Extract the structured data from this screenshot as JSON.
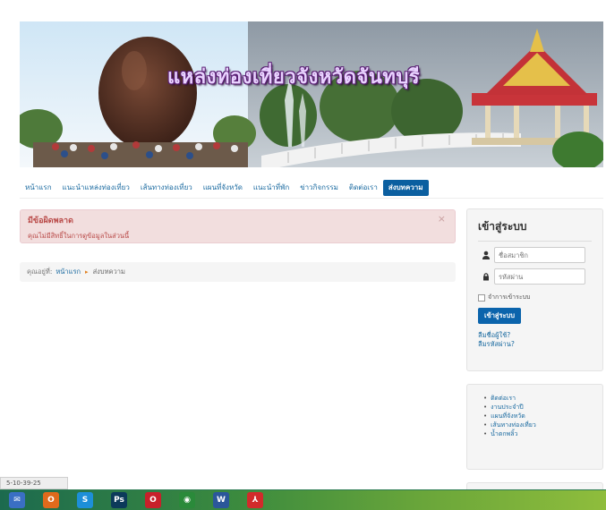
{
  "banner": {
    "title": "แหล่งท่องเที่ยวจังหวัดจันทบุรี"
  },
  "nav": {
    "items": [
      {
        "label": "หน้าแรก"
      },
      {
        "label": "แนะนำแหล่งท่องเที่ยว"
      },
      {
        "label": "เส้นทางท่องเที่ยว"
      },
      {
        "label": "แผนที่จังหวัด"
      },
      {
        "label": "แนะนำที่พัก"
      },
      {
        "label": "ข่าวกิจกรรม"
      },
      {
        "label": "ติดต่อเรา"
      },
      {
        "label": "ส่งบทความ",
        "active": true
      }
    ]
  },
  "alert": {
    "heading": "มีข้อผิดพลาด",
    "message": "คุณไม่มีสิทธิ์ในการดูข้อมูลในส่วนนี้",
    "close": "×"
  },
  "breadcrumb": {
    "prefix": "คุณอยู่ที่:",
    "home": "หน้าแรก",
    "separator": "▸",
    "current": "ส่งบทความ"
  },
  "login": {
    "title": "เข้าสู่ระบบ",
    "username_placeholder": "ชื่อสมาชิก",
    "password_placeholder": "รหัสผ่าน",
    "remember": "จำการเข้าระบบ",
    "submit": "เข้าสู่ระบบ",
    "forgot_username": "ลืมชื่อผู้ใช้?",
    "forgot_password": "ลืมรหัสผ่าน?"
  },
  "links": {
    "items": [
      {
        "label": "ติดต่อเรา"
      },
      {
        "label": "งานประจำปี"
      },
      {
        "label": "แผนที่จังหวัด"
      },
      {
        "label": "เส้นทางท่องเที่ยว"
      },
      {
        "label": "น้ำตกพลิ้ว"
      }
    ]
  },
  "status": {
    "text": "5-10-39-25"
  },
  "taskbar": {
    "icons": [
      {
        "name": "mail-icon",
        "glyph": "✉",
        "color": "#3a6fc4"
      },
      {
        "name": "office-icon",
        "glyph": "O",
        "color": "#e06a1c"
      },
      {
        "name": "skype-icon",
        "glyph": "S",
        "color": "#1d8fd8"
      },
      {
        "name": "photoshop-icon",
        "glyph": "Ps",
        "color": "#0c3a5a"
      },
      {
        "name": "opera-icon",
        "glyph": "O",
        "color": "#c8202a"
      },
      {
        "name": "chrome-icon",
        "glyph": "◉",
        "color": "#2a8a3a"
      },
      {
        "name": "word-icon",
        "glyph": "W",
        "color": "#2b579a"
      },
      {
        "name": "pdf-icon",
        "glyph": "⅄",
        "color": "#d12b2b"
      }
    ]
  }
}
